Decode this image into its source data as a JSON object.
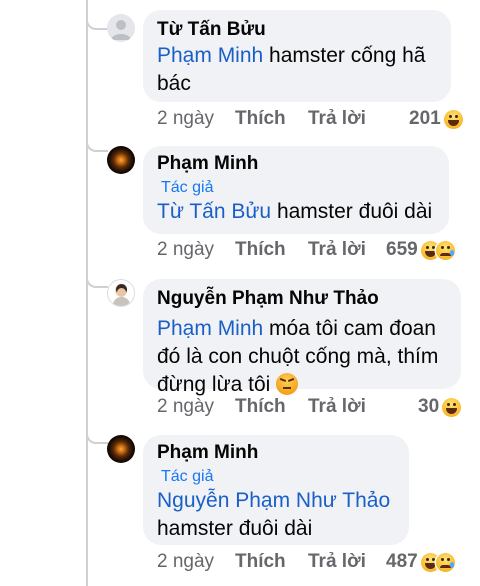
{
  "comments": [
    {
      "author": "Từ Tấn Bửu",
      "badge": "",
      "mention": "Phạm Minh",
      "text_after_mention": " hamster cống hã bác",
      "time": "2 ngày",
      "like_label": "Thích",
      "reply_label": "Trả lời",
      "reaction_count": "201",
      "reactions": [
        "haha-icon"
      ]
    },
    {
      "author": "Phạm Minh",
      "badge": "Tác giả",
      "mention": "Từ Tấn Bửu",
      "text_after_mention": " hamster đuôi dài",
      "time": "2 ngày",
      "like_label": "Thích",
      "reply_label": "Trả lời",
      "reaction_count": "659",
      "reactions": [
        "haha-icon",
        "sad-icon"
      ]
    },
    {
      "author": "Nguyễn Phạm Như Thảo",
      "badge": "",
      "mention": "Phạm Minh",
      "text_after_mention": " móa tôi cam đoan đó là con chuột cống mà, thím đừng lừa tôi",
      "inline_emoji": "angry-face-icon",
      "time": "2 ngày",
      "like_label": "Thích",
      "reply_label": "Trả lời",
      "reaction_count": "30",
      "reactions": [
        "haha-icon"
      ]
    },
    {
      "author": "Phạm Minh",
      "badge": "Tác giả",
      "mention": "Nguyễn Phạm Như Thảo",
      "text_after_mention": "hamster đuôi dài",
      "time": "2 ngày",
      "like_label": "Thích",
      "reply_label": "Trả lời",
      "reaction_count": "487",
      "reactions": [
        "haha-icon",
        "sad-icon"
      ]
    }
  ],
  "colors": {
    "bubble": "#f0f2f5",
    "mention": "#1a5fc8",
    "badge": "#1877f2",
    "meta": "#65676b"
  }
}
